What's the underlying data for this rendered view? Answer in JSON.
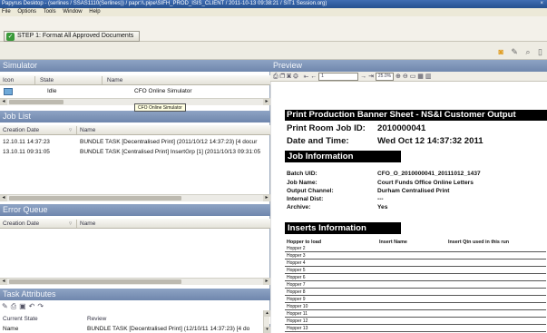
{
  "window": {
    "title": "Papyrus Desktop - (serlines / SSAS1110(Serlines)) / papr:\\\\.pipe\\SIFH_PROD_ISIS_CLIENT / 2011-10-13 09:38:21 / SIT1 Session.org)",
    "close_label": "×"
  },
  "menu": [
    "File",
    "Options",
    "Tools",
    "Window",
    "Help"
  ],
  "step_button": {
    "label": "STEP 1: Format All Approved Documents",
    "icon": "check-icon"
  },
  "colors": {
    "panel_header": "#7f96ba",
    "title_bar": "#2f5d9f",
    "accent_icon": "#e09a1a"
  },
  "simulator": {
    "title": "Simulator",
    "columns": [
      "Icon",
      "State",
      "Name"
    ],
    "rows": [
      {
        "icon": "simulator-icon",
        "state": "Idle",
        "name": "CFO Online Simulator"
      }
    ],
    "tooltip": "CFO Online Simulator"
  },
  "job_list": {
    "title": "Job List",
    "columns": [
      "Creation Date",
      "Name"
    ],
    "rows": [
      {
        "date": "12.10.11 14:37:23",
        "name": "BUNDLE TASK [Decentralised Print] (2011/10/12 14:37:23) [4 docur"
      },
      {
        "date": "13.10.11 09:31:05",
        "name": "BUNDLE TASK [Centralised Print] InsertGrp [1] (2011/10/13 09:31:05"
      }
    ]
  },
  "error_queue": {
    "title": "Error Queue",
    "columns": [
      "Creation Date",
      "Name"
    ]
  },
  "task_attributes": {
    "title": "Task Attributes",
    "columns": [
      "Current State",
      "Review"
    ],
    "rows": [
      {
        "state": "Name",
        "review": "BUNDLE TASK [Decentralised Print] (12/10/11 14:37:23) [4 do"
      }
    ]
  },
  "preview": {
    "title": "Preview",
    "zoom": "25.0%",
    "page_field": "1",
    "document": {
      "banner": "Print Production Banner Sheet - NS&I Customer Output",
      "print_room_job_id_label": "Print Room Job ID:",
      "print_room_job_id": "2010000041",
      "date_time_label": "Date and Time:",
      "date_time": "Wed Oct 12 14:37:32 2011",
      "job_info_heading": "Job Information",
      "fields": [
        {
          "label": "Batch UID:",
          "value": "CFO_O_2010000041_20111012_1437"
        },
        {
          "label": "Job Name:",
          "value": "Court Funds Office Online Letters"
        },
        {
          "label": "Output Channel:",
          "value": "Durham Centralised Print"
        },
        {
          "label": "Internal Dist:",
          "value": "---"
        },
        {
          "label": "Archive:",
          "value": "Yes"
        }
      ],
      "inserts_heading": "Inserts Information",
      "inserts_columns": [
        "Hopper to load",
        "Insert Name",
        "Insert Qtn used in this run"
      ],
      "hoppers": [
        "Hopper 2",
        "Hopper 3",
        "Hopper 4",
        "Hopper 5",
        "Hopper 6",
        "Hopper 7",
        "Hopper 8",
        "Hopper 9",
        "Hopper 10",
        "Hopper 11",
        "Hopper 12",
        "Hopper 13"
      ]
    }
  }
}
